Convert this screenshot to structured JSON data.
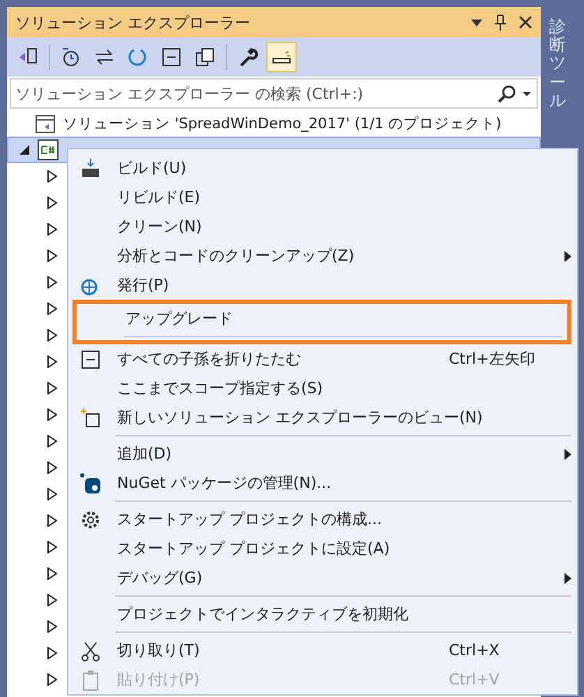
{
  "panel": {
    "title": "ソリューション エクスプローラー",
    "toolbar": [
      {
        "kind": "vs",
        "selected": false
      },
      {
        "kind": "history",
        "selected": false
      },
      {
        "kind": "sync",
        "selected": false
      },
      {
        "kind": "refresh",
        "selected": false
      },
      {
        "kind": "collapse",
        "selected": false
      },
      {
        "kind": "copy",
        "selected": false
      },
      {
        "kind": "wrench",
        "selected": false
      },
      {
        "kind": "preview",
        "selected": true
      }
    ],
    "search": {
      "placeholder": "ソリューション エクスプローラー の検索 (Ctrl+:)"
    },
    "tree": {
      "solution": "ソリューション 'SpreadWinDemo_2017' (1/1 のプロジェクト)",
      "project": {
        "selected": true,
        "expanded": true,
        "children": [
          {
            "expanded": false
          },
          {
            "expanded": false
          },
          {
            "expanded": false
          },
          {
            "expanded": false
          },
          {
            "expanded": false
          },
          {
            "expanded": false
          },
          {
            "expanded": false
          },
          {
            "expanded": false
          },
          {
            "expanded": false
          },
          {
            "expanded": false
          },
          {
            "expanded": false
          },
          {
            "expanded": false
          },
          {
            "expanded": false
          },
          {
            "expanded": false
          },
          {
            "expanded": false
          },
          {
            "expanded": false
          },
          {
            "expanded": false
          },
          {
            "expanded": false
          },
          {
            "expanded": false
          },
          {
            "expanded": false
          }
        ]
      }
    }
  },
  "side_tab": "診断ツール",
  "context_menu": [
    {
      "kind": "item",
      "label": "ビルド(U)",
      "submenu": false,
      "disabled": false,
      "highlighted": false
    },
    {
      "kind": "item",
      "label": "リビルド(E)",
      "submenu": false,
      "disabled": false,
      "highlighted": false
    },
    {
      "kind": "item",
      "label": "クリーン(N)",
      "submenu": false,
      "disabled": false,
      "highlighted": false
    },
    {
      "kind": "item",
      "label": "分析とコードのクリーンアップ(Z)",
      "submenu": true,
      "disabled": false,
      "highlighted": false
    },
    {
      "kind": "item",
      "label": "発行(P)",
      "submenu": false,
      "disabled": false,
      "highlighted": false
    },
    {
      "kind": "item",
      "label": "アップグレード",
      "submenu": false,
      "disabled": false,
      "highlighted": true
    },
    {
      "kind": "separator"
    },
    {
      "kind": "item",
      "label": "すべての子孫を折りたたむ",
      "shortcut": "Ctrl+左矢印",
      "submenu": false,
      "disabled": false,
      "highlighted": false
    },
    {
      "kind": "item",
      "label": "ここまでスコープ指定する(S)",
      "submenu": false,
      "disabled": false,
      "highlighted": false
    },
    {
      "kind": "item",
      "label": "新しいソリューション エクスプローラーのビュー(N)",
      "submenu": false,
      "disabled": false,
      "highlighted": false
    },
    {
      "kind": "separator"
    },
    {
      "kind": "item",
      "label": "追加(D)",
      "submenu": true,
      "disabled": false,
      "highlighted": false
    },
    {
      "kind": "item",
      "label": "NuGet パッケージの管理(N)...",
      "submenu": false,
      "disabled": false,
      "highlighted": false
    },
    {
      "kind": "separator"
    },
    {
      "kind": "item",
      "label": "スタートアップ プロジェクトの構成...",
      "submenu": false,
      "disabled": false,
      "highlighted": false
    },
    {
      "kind": "item",
      "label": "スタートアップ プロジェクトに設定(A)",
      "submenu": false,
      "disabled": false,
      "highlighted": false
    },
    {
      "kind": "item",
      "label": "デバッグ(G)",
      "submenu": true,
      "disabled": false,
      "highlighted": false
    },
    {
      "kind": "separator"
    },
    {
      "kind": "item",
      "label": "プロジェクトでインタラクティブを初期化",
      "submenu": false,
      "disabled": false,
      "highlighted": false
    },
    {
      "kind": "separator"
    },
    {
      "kind": "item",
      "label": "切り取り(T)",
      "shortcut": "Ctrl+X",
      "submenu": false,
      "disabled": false,
      "highlighted": false
    },
    {
      "kind": "item",
      "label": "貼り付け(P)",
      "shortcut": "Ctrl+V",
      "submenu": false,
      "disabled": true,
      "highlighted": false
    }
  ]
}
